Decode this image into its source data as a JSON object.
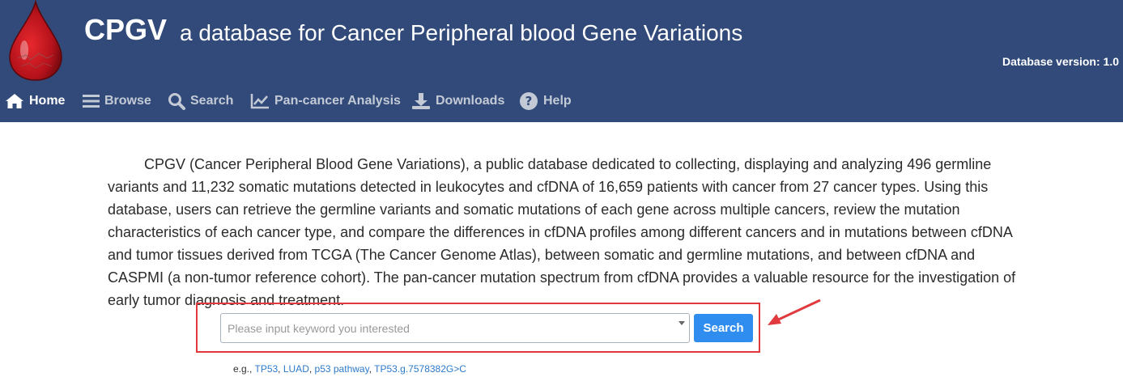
{
  "header": {
    "title": "CPGV",
    "subtitle": "a database for Cancer Peripheral blood Gene Variations",
    "version": "Database version: 1.0",
    "background_color": "#314a79"
  },
  "nav": {
    "items": [
      {
        "label": "Home",
        "icon": "home-icon",
        "active": true
      },
      {
        "label": "Browse",
        "icon": "list-icon",
        "active": false
      },
      {
        "label": "Search",
        "icon": "search-icon",
        "active": false
      },
      {
        "label": "Pan-cancer Analysis",
        "icon": "line-chart-icon",
        "active": false
      },
      {
        "label": "Downloads",
        "icon": "download-icon",
        "active": false
      },
      {
        "label": "Help",
        "icon": "question-circle-icon",
        "active": false
      }
    ]
  },
  "intro": {
    "text": "CPGV (Cancer Peripheral Blood Gene Variations), a public database dedicated to collecting, displaying and analyzing 496 germline variants and 11,232 somatic mutations detected in leukocytes and cfDNA of 16,659 patients with cancer from 27 cancer types. Using this database, users can retrieve the germline variants and somatic mutations of each gene across multiple cancers, review the mutation characteristics of each cancer type, and compare the differences in cfDNA profiles among different cancers and in mutations between cfDNA and tumor tissues derived from TCGA (The Cancer Genome Atlas), between somatic and germline mutations, and between cfDNA and CASPMI (a non-tumor reference cohort). The pan-cancer mutation spectrum from cfDNA provides a valuable resource for the investigation of early tumor diagnosis and treatment."
  },
  "search": {
    "placeholder": "Please input keyword you interested",
    "value": "",
    "button_label": "Search",
    "highlight_color": "#e03a3e",
    "button_color": "#2e8def"
  },
  "examples": {
    "prefix": "e.g.,",
    "items": [
      "TP53",
      "LUAD",
      "p53 pathway",
      "TP53.g.7578382G>C"
    ]
  }
}
